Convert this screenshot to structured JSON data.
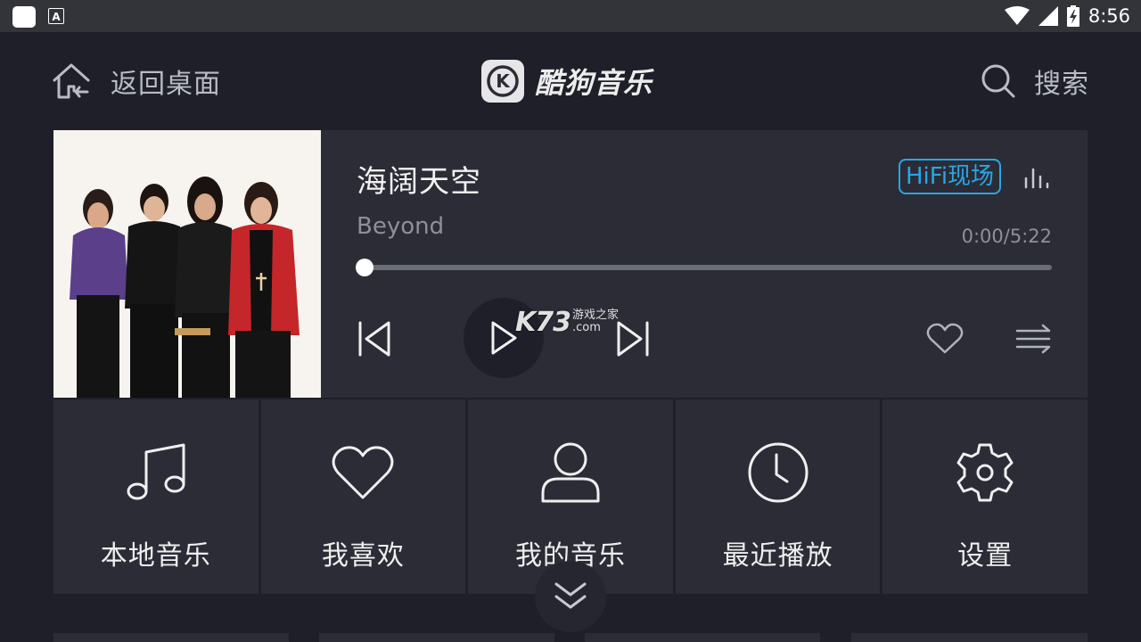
{
  "status_bar": {
    "time": "8:56"
  },
  "header": {
    "home_label": "返回桌面",
    "app_name": "酷狗音乐",
    "logo_letter": "K",
    "search_label": "搜索"
  },
  "player": {
    "song_title": "海阔天空",
    "artist": "Beyond",
    "quality_badge": "HiFi现场",
    "time": "0:00/5:22",
    "progress": 0,
    "accent_color": "#29a6e6"
  },
  "watermark": {
    "main": "K73",
    "top": "游戏之家",
    "bottom": ".com"
  },
  "menu": [
    {
      "label": "本地音乐",
      "icon": "music-note-icon"
    },
    {
      "label": "我喜欢",
      "icon": "heart-icon"
    },
    {
      "label": "我的音乐",
      "icon": "user-icon"
    },
    {
      "label": "最近播放",
      "icon": "clock-icon"
    },
    {
      "label": "设置",
      "icon": "gear-icon"
    }
  ]
}
